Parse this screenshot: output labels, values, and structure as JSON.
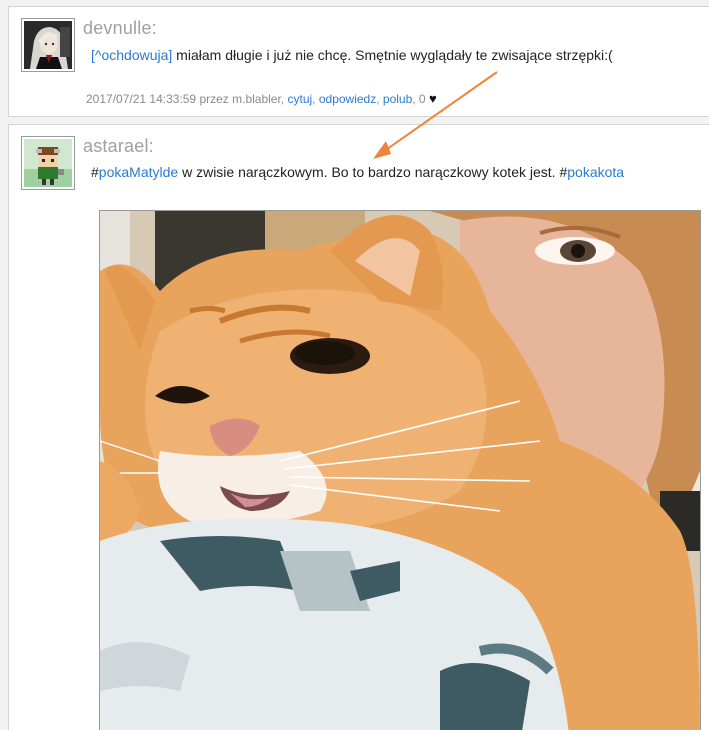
{
  "posts": [
    {
      "username": "devnulle:",
      "reply_to_prefix": "[^",
      "reply_to_user": "ochdowuja",
      "reply_to_suffix": "]",
      "text": " miałam długie i już nie chcę. Smętnie wyglądały te zwisające strzępki:(",
      "meta": {
        "timestamp_author": "2017/07/21 14:33:59 przez m.blabler, ",
        "quote": "cytuj",
        "sep1": ", ",
        "reply": "odpowiedz",
        "sep2": ", ",
        "like": "polub",
        "likes_count": ", 0 ",
        "heart": "♥"
      }
    },
    {
      "username": "astarael:",
      "hash1_symbol": "#",
      "hash1_tag": "pokaMatylde",
      "text": " w zwisie narączkowym. Bo to bardzo narączkowy kotek jest. ",
      "hash2_symbol": "#",
      "hash2_tag": "pokakota"
    }
  ],
  "colors": {
    "link": "#2a7bd0",
    "username": "#a0a0a0",
    "arrow": "#f0843a"
  },
  "icons": {
    "post1_avatar": "anime-girl-avatar-icon",
    "post2_avatar": "pixel-character-avatar-icon",
    "photo": "orange-cat-selfie-photo",
    "arrow": "orange-arrow-annotation"
  }
}
